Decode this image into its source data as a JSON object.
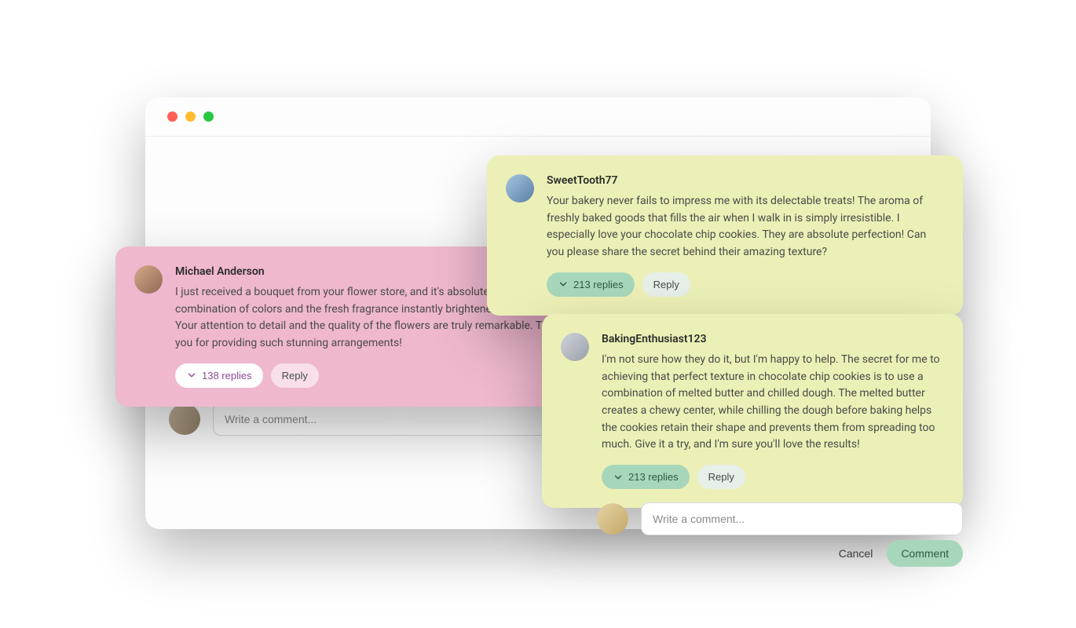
{
  "window": {
    "traffic": [
      "red",
      "yellow",
      "green"
    ]
  },
  "cards": {
    "pink": {
      "username": "Michael Anderson",
      "text": "I just received a bouquet from your flower store, and it's absolutely stunning! The combination of colors and the fresh fragrance instantly brightened up my day. Your attention to detail and the quality of the flowers are truly remarkable. Thank you for providing such stunning arrangements!",
      "replies_label": "138 replies",
      "reply_label": "Reply"
    },
    "yel1": {
      "username": "SweetTooth77",
      "text": "Your bakery never fails to impress me with its delectable treats! The aroma of freshly baked goods that fills the air when I walk in is simply irresistible. I especially love your chocolate chip cookies. They are absolute perfection! Can you please share the secret behind their amazing texture?",
      "replies_label": "213 replies",
      "reply_label": "Reply"
    },
    "yel2": {
      "username": "BakingEnthusiast123",
      "text": "I'm not sure how they do it, but I'm happy to help. The secret for me to achieving that perfect texture in chocolate chip cookies is to use a combination of melted butter and chilled dough. The melted butter creates a chewy center, while chilling the dough before baking helps the cookies retain their shape and prevents them from spreading too much. Give it a try, and I'm sure you'll love the results!",
      "replies_label": "213 replies",
      "reply_label": "Reply"
    }
  },
  "composer": {
    "placeholder": "Write a comment...",
    "cancel": "Cancel",
    "submit": "Comment"
  }
}
